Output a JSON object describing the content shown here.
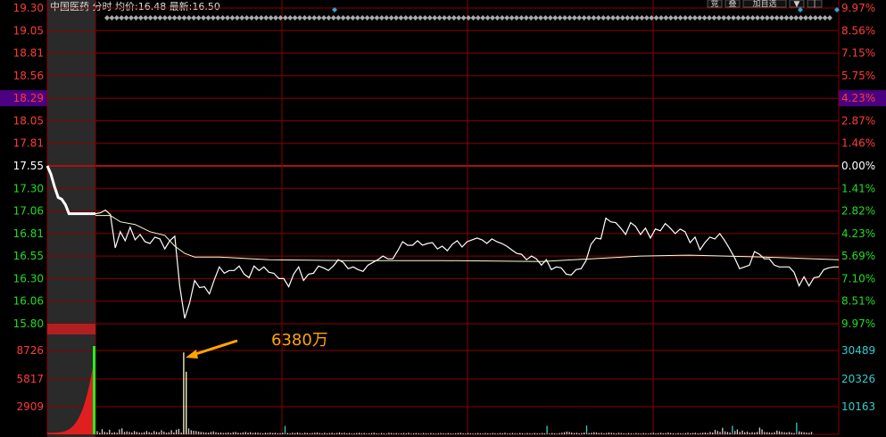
{
  "header": {
    "title_text": "中国医药 分时 均价:16.48 最新:16.50",
    "buttons": [
      "竞",
      "叠",
      "加自选",
      "▼",
      "|"
    ]
  },
  "colors": {
    "background": "#000000",
    "grid": "#8b0000",
    "axis_up": "#ff3b3b",
    "axis_down": "#22dd22",
    "axis_zero": "#ffffff",
    "volume_axis": "#33cccc",
    "price_line": "#ffffff",
    "avg_line": "#ffffcc",
    "highlight": "#4b0082",
    "annotation": "#ffa500",
    "diamond": "#aaaaaa",
    "diamond_accent": "#3aa0d0"
  },
  "chart_data": {
    "type": "line",
    "prev_close": 17.55,
    "price_ylim": [
      15.8,
      19.3
    ],
    "price_ticks": [
      "19.30",
      "19.05",
      "18.81",
      "18.56",
      "18.29",
      "18.05",
      "17.81",
      "17.55",
      "17.30",
      "17.06",
      "16.81",
      "16.55",
      "16.30",
      "16.06",
      "15.80"
    ],
    "pct_ticks": [
      "9.97%",
      "8.56%",
      "7.15%",
      "5.75%",
      "4.23%",
      "2.87%",
      "1.46%",
      "0.00%",
      "1.41%",
      "2.82%",
      "4.23%",
      "5.69%",
      "7.10%",
      "8.51%",
      "9.97%"
    ],
    "highlight_price": "18.29",
    "highlight_pct": "4.23%",
    "volume_ticks_left": [
      "8726",
      "5817",
      "2909"
    ],
    "volume_ticks_right": [
      "30489",
      "20326",
      "10163"
    ],
    "volume_ylim": [
      0,
      40652
    ],
    "minutes": 240,
    "series": [
      {
        "key": "price",
        "points": [
          [
            0,
            17.02
          ],
          [
            2,
            17.03
          ],
          [
            4,
            17.06
          ],
          [
            6,
            17.01
          ],
          [
            8,
            16.64
          ],
          [
            10,
            16.82
          ],
          [
            12,
            16.72
          ],
          [
            14,
            16.87
          ],
          [
            16,
            16.73
          ],
          [
            18,
            16.79
          ],
          [
            20,
            16.71
          ],
          [
            22,
            16.69
          ],
          [
            24,
            16.76
          ],
          [
            26,
            16.74
          ],
          [
            28,
            16.63
          ],
          [
            30,
            16.72
          ],
          [
            32,
            16.77
          ],
          [
            34,
            16.22
          ],
          [
            36,
            15.86
          ],
          [
            38,
            16.03
          ],
          [
            40,
            16.28
          ],
          [
            42,
            16.2
          ],
          [
            44,
            16.21
          ],
          [
            46,
            16.13
          ],
          [
            48,
            16.29
          ],
          [
            50,
            16.43
          ],
          [
            52,
            16.36
          ],
          [
            54,
            16.39
          ],
          [
            56,
            16.39
          ],
          [
            58,
            16.44
          ],
          [
            60,
            16.35
          ],
          [
            62,
            16.31
          ],
          [
            64,
            16.44
          ],
          [
            66,
            16.39
          ],
          [
            68,
            16.43
          ],
          [
            70,
            16.37
          ],
          [
            72,
            16.36
          ],
          [
            74,
            16.3
          ],
          [
            76,
            16.3
          ],
          [
            78,
            16.21
          ],
          [
            80,
            16.35
          ],
          [
            82,
            16.43
          ],
          [
            84,
            16.28
          ],
          [
            86,
            16.35
          ],
          [
            88,
            16.36
          ],
          [
            90,
            16.44
          ],
          [
            92,
            16.42
          ],
          [
            94,
            16.39
          ],
          [
            96,
            16.44
          ],
          [
            98,
            16.51
          ],
          [
            100,
            16.48
          ],
          [
            102,
            16.41
          ],
          [
            104,
            16.43
          ],
          [
            106,
            16.4
          ],
          [
            108,
            16.38
          ],
          [
            110,
            16.45
          ],
          [
            112,
            16.48
          ],
          [
            114,
            16.51
          ],
          [
            116,
            16.55
          ],
          [
            118,
            16.52
          ],
          [
            120,
            16.52
          ],
          [
            122,
            16.61
          ],
          [
            124,
            16.71
          ],
          [
            126,
            16.67
          ],
          [
            128,
            16.67
          ],
          [
            130,
            16.72
          ],
          [
            132,
            16.67
          ],
          [
            134,
            16.69
          ],
          [
            136,
            16.7
          ],
          [
            138,
            16.63
          ],
          [
            140,
            16.66
          ],
          [
            142,
            16.61
          ],
          [
            144,
            16.68
          ],
          [
            146,
            16.72
          ],
          [
            148,
            16.65
          ],
          [
            150,
            16.71
          ],
          [
            152,
            16.73
          ],
          [
            154,
            16.75
          ],
          [
            156,
            16.73
          ],
          [
            158,
            16.69
          ],
          [
            160,
            16.74
          ],
          [
            162,
            16.71
          ],
          [
            164,
            16.69
          ],
          [
            166,
            16.66
          ],
          [
            168,
            16.62
          ],
          [
            170,
            16.58
          ],
          [
            172,
            16.57
          ],
          [
            174,
            16.51
          ],
          [
            176,
            16.55
          ],
          [
            178,
            16.52
          ],
          [
            180,
            16.45
          ],
          [
            182,
            16.51
          ],
          [
            184,
            16.4
          ],
          [
            186,
            16.43
          ],
          [
            188,
            16.42
          ],
          [
            190,
            16.35
          ],
          [
            192,
            16.34
          ],
          [
            194,
            16.4
          ],
          [
            196,
            16.41
          ],
          [
            198,
            16.5
          ],
          [
            200,
            16.68
          ],
          [
            202,
            16.75
          ],
          [
            204,
            16.74
          ],
          [
            206,
            16.97
          ],
          [
            208,
            16.93
          ],
          [
            210,
            16.92
          ],
          [
            212,
            16.86
          ],
          [
            214,
            16.79
          ],
          [
            216,
            16.92
          ],
          [
            218,
            16.88
          ],
          [
            220,
            16.79
          ],
          [
            222,
            16.86
          ],
          [
            224,
            16.75
          ],
          [
            226,
            16.85
          ],
          [
            228,
            16.83
          ],
          [
            230,
            16.91
          ],
          [
            232,
            16.86
          ],
          [
            234,
            16.8
          ],
          [
            236,
            16.85
          ],
          [
            238,
            16.82
          ],
          [
            240,
            16.7
          ],
          [
            242,
            16.76
          ],
          [
            244,
            16.62
          ],
          [
            246,
            16.7
          ],
          [
            248,
            16.76
          ],
          [
            250,
            16.74
          ],
          [
            252,
            16.8
          ],
          [
            254,
            16.72
          ],
          [
            256,
            16.63
          ],
          [
            258,
            16.53
          ],
          [
            260,
            16.41
          ],
          [
            262,
            16.43
          ],
          [
            264,
            16.45
          ],
          [
            266,
            16.6
          ],
          [
            268,
            16.57
          ],
          [
            270,
            16.52
          ],
          [
            272,
            16.52
          ],
          [
            274,
            16.45
          ],
          [
            276,
            16.43
          ],
          [
            278,
            16.43
          ],
          [
            280,
            16.43
          ],
          [
            282,
            16.37
          ],
          [
            284,
            16.22
          ],
          [
            286,
            16.32
          ],
          [
            288,
            16.22
          ],
          [
            290,
            16.31
          ],
          [
            292,
            16.32
          ],
          [
            294,
            16.4
          ],
          [
            296,
            16.42
          ],
          [
            298,
            16.43
          ],
          [
            300,
            16.43
          ]
        ]
      },
      {
        "key": "avg",
        "points": [
          [
            0,
            17.0
          ],
          [
            6,
            17.0
          ],
          [
            10,
            16.93
          ],
          [
            16,
            16.9
          ],
          [
            22,
            16.82
          ],
          [
            28,
            16.78
          ],
          [
            32,
            16.66
          ],
          [
            36,
            16.58
          ],
          [
            40,
            16.54
          ],
          [
            50,
            16.54
          ],
          [
            70,
            16.51
          ],
          [
            100,
            16.5
          ],
          [
            140,
            16.5
          ],
          [
            180,
            16.49
          ],
          [
            200,
            16.52
          ],
          [
            220,
            16.55
          ],
          [
            240,
            16.56
          ],
          [
            270,
            16.54
          ],
          [
            300,
            16.51
          ]
        ]
      }
    ],
    "pre_market": [
      [
        0,
        17.55
      ],
      [
        3,
        17.46
      ],
      [
        6,
        17.32
      ],
      [
        9,
        17.2
      ],
      [
        12,
        17.18
      ],
      [
        15,
        17.12
      ],
      [
        18,
        17.02
      ],
      [
        40,
        17.02
      ]
    ],
    "volume_minutes": 300,
    "volume": [
      1200,
      600,
      1900,
      900,
      700,
      1700,
      600,
      800,
      600,
      1800,
      2200,
      900,
      1100,
      900,
      700,
      1200,
      900,
      700,
      600,
      800,
      1200,
      800,
      600,
      1200,
      900,
      800,
      1500,
      1000,
      600,
      800,
      1500,
      700,
      1700,
      2000,
      700,
      30100,
      23000,
      2200,
      1500,
      1300,
      1200,
      1000,
      900,
      800,
      700,
      600,
      900,
      1100,
      800,
      600,
      700,
      500,
      600,
      700,
      500,
      800,
      900,
      600,
      500,
      700,
      900,
      600,
      800,
      500,
      700,
      600,
      500,
      400,
      600,
      500,
      700,
      500,
      600,
      400,
      500,
      600,
      3100,
      500,
      400,
      600,
      500,
      700,
      500,
      400,
      600,
      500,
      400,
      500,
      600,
      700,
      500,
      400,
      600,
      400,
      500,
      600,
      400,
      500,
      700,
      500,
      600,
      400,
      500,
      300,
      400,
      500,
      600,
      400,
      500,
      300,
      400,
      500,
      600,
      400,
      300,
      500,
      400,
      300,
      600,
      500,
      400,
      500,
      300,
      400,
      500,
      400,
      600,
      300,
      400,
      500,
      400,
      300,
      500,
      400,
      300,
      500,
      400,
      300,
      400,
      500,
      400,
      300,
      500,
      400,
      300,
      400,
      500,
      600,
      400,
      300,
      500,
      400,
      300,
      400,
      500,
      400,
      300,
      500,
      400,
      300,
      500,
      400,
      300,
      500,
      400,
      600,
      300,
      400,
      500,
      400,
      300,
      500,
      400,
      300,
      500,
      400,
      300,
      500,
      400,
      300,
      500,
      400,
      3100,
      300,
      500,
      400,
      300,
      500,
      600,
      800,
      1000,
      900,
      700,
      500,
      600,
      400,
      500,
      700,
      3200,
      500,
      600,
      800,
      700,
      500,
      600,
      400,
      500,
      700,
      600,
      500,
      400,
      600,
      500,
      400,
      300,
      500,
      400,
      300,
      500,
      400,
      300,
      500,
      400,
      300,
      500,
      600,
      400,
      500,
      600,
      400,
      500,
      700,
      500,
      400,
      300,
      500,
      400,
      300,
      500,
      600,
      400,
      500,
      600,
      400,
      500,
      600,
      700,
      500,
      900,
      700,
      1600,
      1200,
      900,
      2400,
      1100,
      900,
      700,
      3100,
      1200,
      1800,
      900,
      1400,
      800,
      1000,
      600,
      800,
      700,
      900,
      2500,
      1800,
      900,
      800,
      700,
      600,
      800,
      1400,
      1100,
      900,
      800,
      700,
      900,
      600,
      500,
      4300,
      1100,
      900,
      800,
      700,
      600,
      900
    ],
    "annotation": {
      "text": "6380万",
      "minute": 35
    }
  }
}
